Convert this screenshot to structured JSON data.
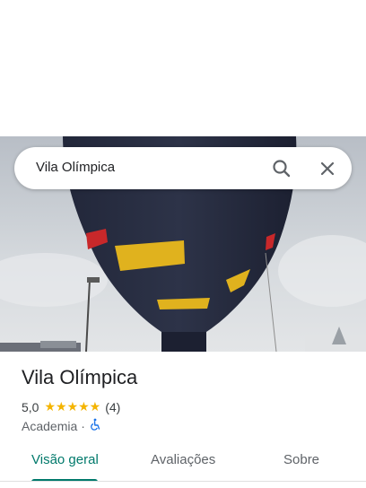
{
  "search": {
    "query": "Vila Olímpica",
    "search_icon": "search-icon",
    "close_icon": "close-icon"
  },
  "place": {
    "name": "Vila Olímpica",
    "rating": "5,0",
    "stars": "★★★★★",
    "review_count": "(4)",
    "category": "Academia",
    "separator": "·",
    "accessibility_icon": "wheelchair-icon"
  },
  "tabs": [
    {
      "label": "Visão geral",
      "active": true
    },
    {
      "label": "Avaliações",
      "active": false
    },
    {
      "label": "Sobre",
      "active": false
    }
  ],
  "colors": {
    "accent": "#00796b",
    "star": "#f4b400",
    "accessibility": "#1a73e8"
  }
}
